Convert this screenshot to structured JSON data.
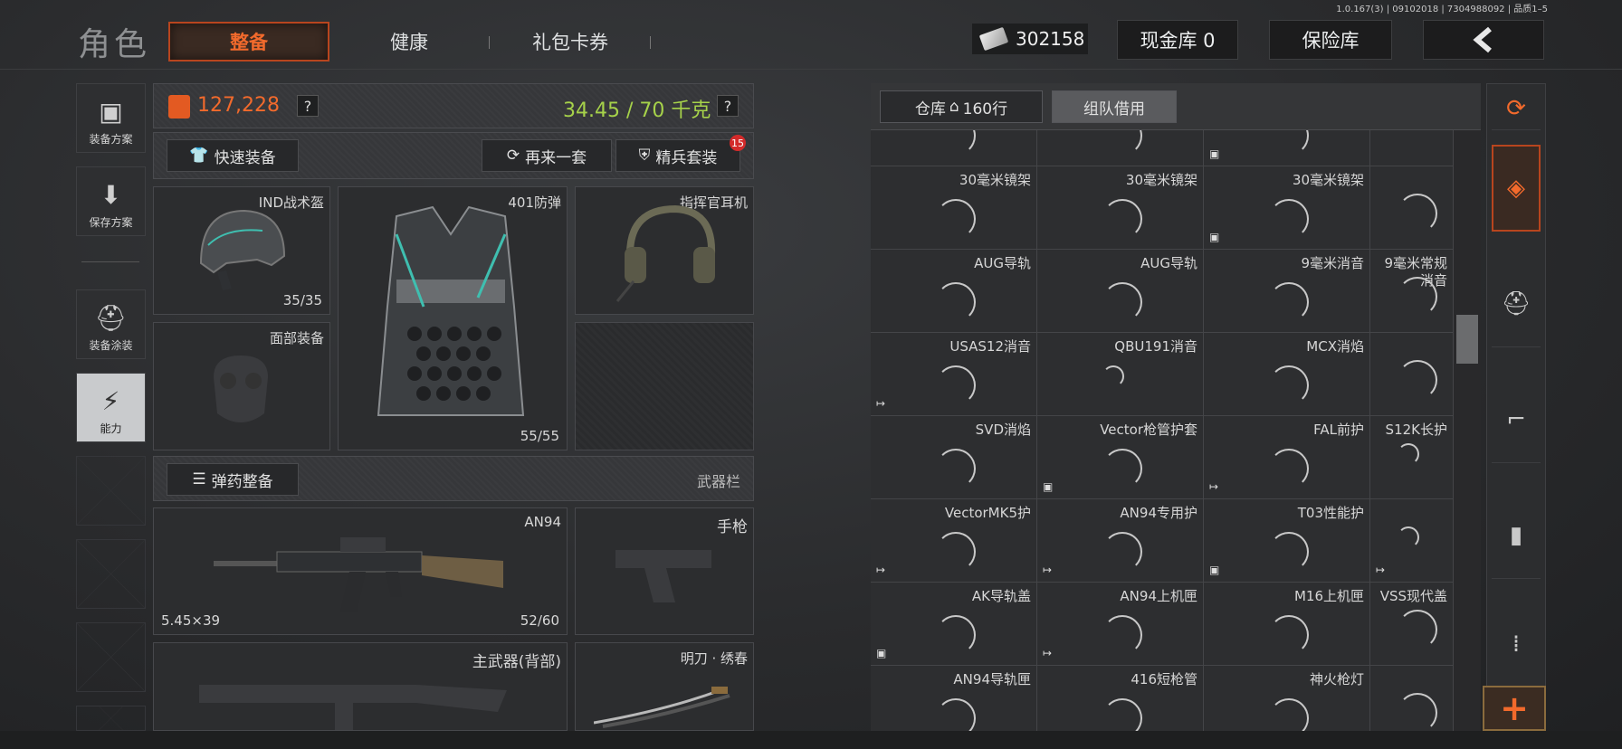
{
  "version": "1.0.167(3) | 09102018 | 7304988092 | 品质1–5",
  "header": {
    "title": "角色",
    "tabs": [
      {
        "label": "整备",
        "active": true
      },
      {
        "label": "健康",
        "active": false
      },
      {
        "label": "礼包卡券",
        "active": false
      }
    ],
    "money": "302158",
    "cash_vault": "现金库 0",
    "safe": "保险库",
    "back_icon": "back-chevron-icon"
  },
  "sidebar": {
    "items": [
      {
        "label": "装备方案",
        "icon": "vest-icon"
      },
      {
        "label": "保存方案",
        "icon": "download-icon"
      },
      {
        "label": "装备涂装",
        "icon": "helmet-paint-icon"
      },
      {
        "label": "能力",
        "icon": "lightning-icon",
        "selected": true
      }
    ]
  },
  "loadout": {
    "value": "127,228",
    "weight": "34.45 / 70 千克",
    "help": "?",
    "quick_equip": "快速装备",
    "again": "再来一套",
    "elite": "精兵套装",
    "elite_badge": "15",
    "slots": {
      "helmet": {
        "label": "IND战术盔",
        "count": "35/35"
      },
      "armor": {
        "label": "401防弹",
        "count": "55/55"
      },
      "headset": {
        "label": "指挥官耳机"
      },
      "face": {
        "label": "面部装备"
      }
    },
    "ammo_button": "弹药整备",
    "weapon_bar": "武器栏",
    "primary": {
      "label": "AN94",
      "caliber": "5.45×39",
      "count": "52/60"
    },
    "pistol": {
      "label": "手枪"
    },
    "secondary": {
      "label": "主武器(背部)"
    },
    "melee": {
      "label": "明刀 · 绣春"
    }
  },
  "inventory": {
    "tabs": [
      {
        "label": "仓库",
        "extra": "160行",
        "icon": "home-icon"
      },
      {
        "label": "组队借用"
      }
    ],
    "rows": [
      [
        "",
        "",
        "",
        ""
      ],
      [
        "30毫米镜架",
        "30毫米镜架",
        "30毫米镜架",
        ""
      ],
      [
        "AUG导轨",
        "AUG导轨",
        "9毫米消音",
        "9毫米常规消音"
      ],
      [
        "USAS12消音",
        "QBU191消音",
        "MCX消焰",
        ""
      ],
      [
        "SVD消焰",
        "Vector枪管护套",
        "FAL前护",
        "S12K长护"
      ],
      [
        "VectorMK5护",
        "AN94专用护",
        "T03性能护",
        ""
      ],
      [
        "AK导轨盖",
        "AN94上机匣",
        "M16上机匣",
        "VSS现代盖"
      ],
      [
        "AN94导轨匣",
        "416短枪管",
        "神火枪灯",
        ""
      ]
    ]
  },
  "rail": {
    "icons": [
      "stack-refresh-icon",
      "stack-active-icon",
      "helmet-icon",
      "rifle-icon",
      "magazine-icon",
      "ammo-icon"
    ],
    "add": "+"
  }
}
